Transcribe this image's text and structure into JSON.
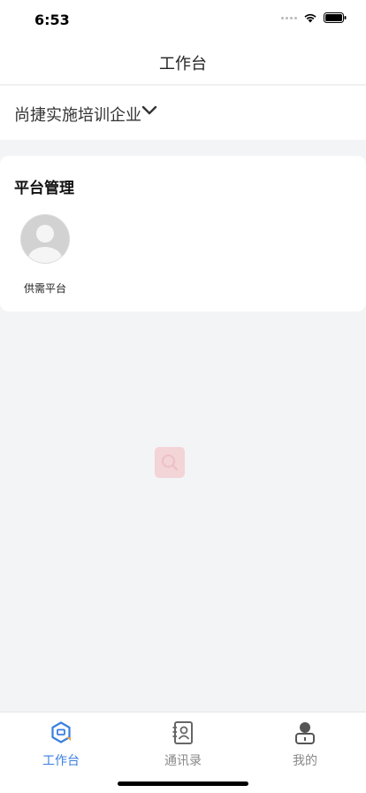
{
  "status_bar": {
    "time": "6:53"
  },
  "nav": {
    "title": "工作台"
  },
  "company": {
    "name": "尚捷实施培训企业"
  },
  "section": {
    "title": "平台管理",
    "apps": [
      {
        "label": "供需平台",
        "icon": "user-avatar-icon"
      }
    ]
  },
  "tabs": [
    {
      "label": "工作台",
      "icon": "workbench-icon",
      "active": true
    },
    {
      "label": "通讯录",
      "icon": "contacts-icon",
      "active": false
    },
    {
      "label": "我的",
      "icon": "profile-icon",
      "active": false
    }
  ],
  "colors": {
    "accent": "#3a7fe0",
    "background": "#f3f4f6",
    "inactive": "#888888"
  }
}
